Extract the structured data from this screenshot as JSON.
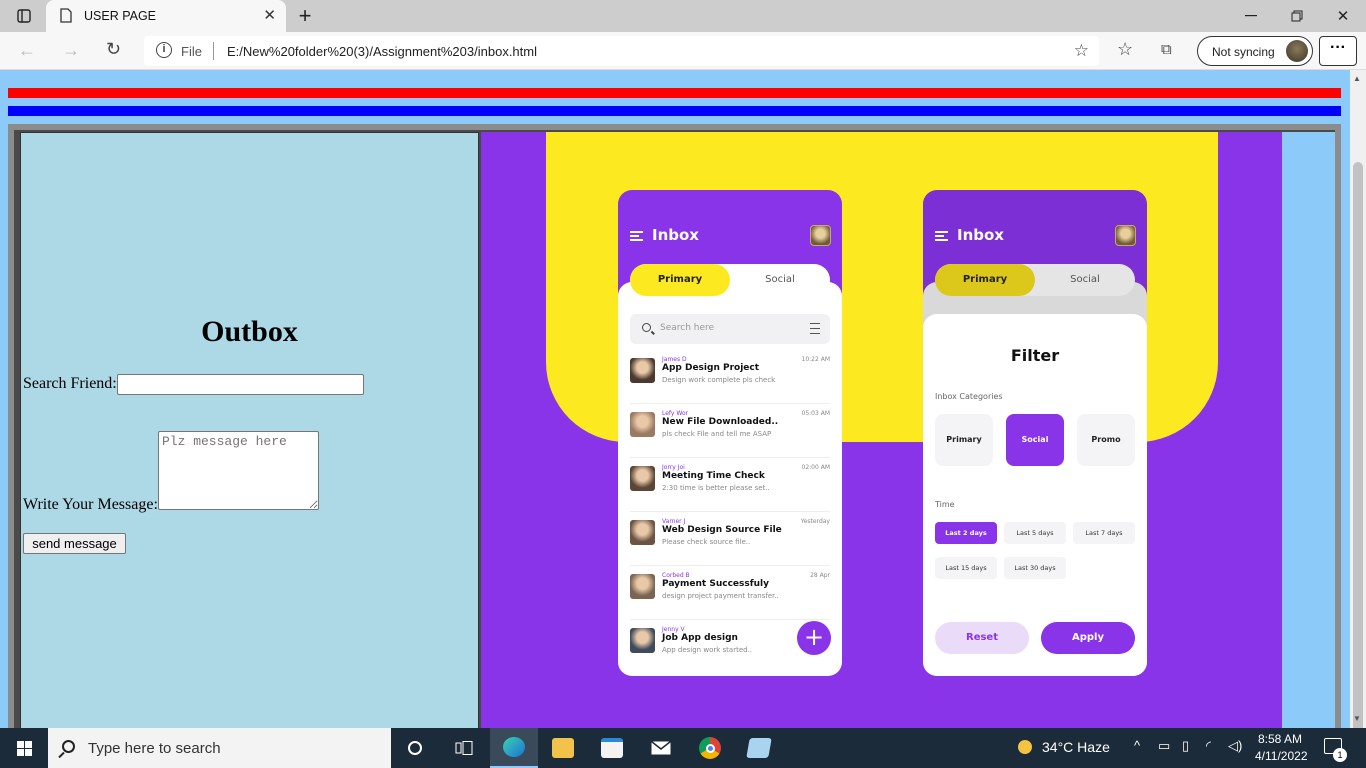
{
  "browser": {
    "tab_title": "USER PAGE",
    "address_scheme": "File",
    "url": "E:/New%20folder%20(3)/Assignment%203/inbox.html",
    "sync_label": "Not syncing",
    "menu_label": "···"
  },
  "outbox": {
    "title": "Outbox",
    "search_label": "Search Friend:",
    "search_value": "",
    "message_label": "Write Your Message:",
    "message_placeholder": "Plz message here",
    "send_label": "send message"
  },
  "inbox_app": {
    "title": "Inbox",
    "tabs": [
      "Primary",
      "Social"
    ],
    "search_placeholder": "Search here",
    "messages": [
      {
        "from": "James D",
        "subject": "App Design Project",
        "preview": "Design work complete pls check",
        "time": "10:22 AM",
        "avatar_color": "#4a3a2e"
      },
      {
        "from": "Lefy Wor",
        "subject": "New File Downloaded..",
        "preview": "pls check File and tell me ASAP",
        "time": "05:03 AM",
        "avatar_color": "#9a7b62"
      },
      {
        "from": "Jorry Joi",
        "subject": "Meeting Time Check",
        "preview": "2:30 time is better please set..",
        "time": "02:00 AM",
        "avatar_color": "#5a4636"
      },
      {
        "from": "Varner J",
        "subject": "Web Design Source File",
        "preview": "Please check source file..",
        "time": "Yesterday",
        "avatar_color": "#6b5444"
      },
      {
        "from": "Corbed B",
        "subject": "Payment Successfuly",
        "preview": "design project payment transfer..",
        "time": "28 Apr",
        "avatar_color": "#7a6552"
      },
      {
        "from": "Jenny V",
        "subject": "Job App design",
        "preview": "App design work started..",
        "time": "",
        "avatar_color": "#3f4a5c"
      }
    ],
    "fab_label": "+"
  },
  "filter": {
    "title": "Filter",
    "categories_label": "Inbox Categories",
    "categories": [
      "Primary",
      "Social",
      "Promo"
    ],
    "selected_category": "Social",
    "time_label": "Time",
    "time_options": [
      "Last 2 days",
      "Last 5 days",
      "Last 7 days",
      "Last 15 days",
      "Last 30 days"
    ],
    "selected_time": "Last 2 days",
    "reset_label": "Reset",
    "apply_label": "Apply"
  },
  "taskbar": {
    "search_placeholder": "Type here to search",
    "weather": "34°C Haze",
    "time": "8:58 AM",
    "date": "4/11/2022",
    "notification_count": "1"
  },
  "colors": {
    "page_bg": "#8ccafa",
    "red_bar": "#ff0000",
    "blue_bar": "#0000ff",
    "outbox_bg": "#add8e6",
    "purple": "#8a34ea",
    "yellow": "#fde91f"
  }
}
